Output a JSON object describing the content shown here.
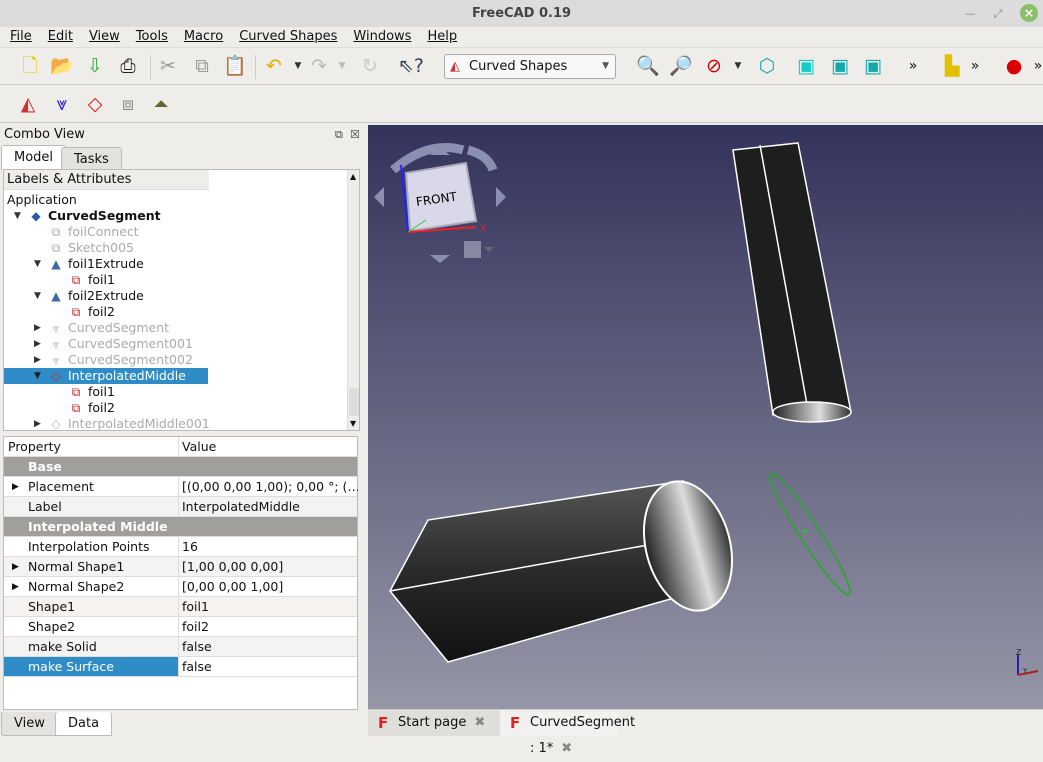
{
  "window": {
    "title": "FreeCAD 0.19"
  },
  "menu": [
    "File",
    "Edit",
    "View",
    "Tools",
    "Macro",
    "Curved Shapes",
    "Windows",
    "Help"
  ],
  "toolbar": {
    "workbench": "Curved Shapes",
    "overflow": "»"
  },
  "combo": {
    "title": "Combo View",
    "tabs": [
      "Model",
      "Tasks"
    ],
    "active_tab": "Model"
  },
  "tree": {
    "header": "Labels & Attributes",
    "root": "Application",
    "items": [
      {
        "label": "CurvedSegment",
        "level": 1,
        "expanded": true,
        "bold": true,
        "icon": "document-icon"
      },
      {
        "label": "foilConnect",
        "level": 2,
        "dim": true,
        "icon": "sketch-icon"
      },
      {
        "label": "Sketch005",
        "level": 2,
        "dim": true,
        "icon": "sketch-icon"
      },
      {
        "label": "foil1Extrude",
        "level": 2,
        "expanded": true,
        "icon": "extrude-icon"
      },
      {
        "label": "foil1",
        "level": 3,
        "icon": "sketch-icon"
      },
      {
        "label": "foil2Extrude",
        "level": 2,
        "expanded": true,
        "icon": "extrude-icon"
      },
      {
        "label": "foil2",
        "level": 3,
        "icon": "sketch-icon"
      },
      {
        "label": "CurvedSegment",
        "level": 2,
        "collapsed": true,
        "dim": true,
        "icon": "curved-segment-icon"
      },
      {
        "label": "CurvedSegment001",
        "level": 2,
        "collapsed": true,
        "dim": true,
        "icon": "curved-segment-icon"
      },
      {
        "label": "CurvedSegment002",
        "level": 2,
        "collapsed": true,
        "dim": true,
        "icon": "curved-segment-icon"
      },
      {
        "label": "InterpolatedMiddle",
        "level": 2,
        "expanded": true,
        "selected": true,
        "icon": "interpolated-middle-icon"
      },
      {
        "label": "foil1",
        "level": 3,
        "icon": "sketch-icon"
      },
      {
        "label": "foil2",
        "level": 3,
        "icon": "sketch-icon"
      },
      {
        "label": "InterpolatedMiddle001",
        "level": 2,
        "collapsed": true,
        "dim": true,
        "icon": "interpolated-middle-icon"
      }
    ]
  },
  "properties": {
    "headers": [
      "Property",
      "Value"
    ],
    "rows": [
      {
        "group": "Base"
      },
      {
        "name": "Placement",
        "value": "[(0,00 0,00 1,00); 0,00 °; (…",
        "expandable": true
      },
      {
        "name": "Label",
        "value": "InterpolatedMiddle"
      },
      {
        "group": "Interpolated Middle"
      },
      {
        "name": "Interpolation Points",
        "value": "16"
      },
      {
        "name": "Normal Shape1",
        "value": "[1,00 0,00 0,00]",
        "expandable": true
      },
      {
        "name": "Normal Shape2",
        "value": "[0,00 0,00 1,00]",
        "expandable": true
      },
      {
        "name": "Shape1",
        "value": "foil1"
      },
      {
        "name": "Shape2",
        "value": "foil2"
      },
      {
        "name": "make Solid",
        "value": "false"
      },
      {
        "name": "make Surface",
        "value": "false",
        "selected": true
      }
    ],
    "tabs": [
      "View",
      "Data"
    ],
    "active_tab": "Data"
  },
  "navcube": {
    "face": "FRONT",
    "axes": [
      "X",
      "Y",
      "Z"
    ]
  },
  "doc_tabs": [
    {
      "label": "Start page"
    },
    {
      "label": "CurvedSegment : 1*",
      "active": true
    }
  ],
  "colors": {
    "selection": "#308cc6",
    "viewport_top": "#33335c",
    "viewport_bottom": "#9596a6",
    "curve": "#22aa22"
  }
}
